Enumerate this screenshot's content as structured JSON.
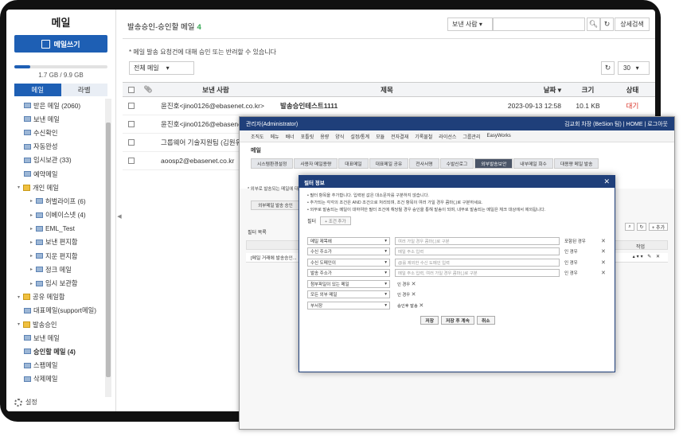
{
  "sidebar": {
    "title": "메일",
    "compose_label": "메일쓰기",
    "quota": {
      "text": "1.7 GB / 9.9 GB",
      "fraction": 0.17
    },
    "tabs": [
      "메일",
      "라벨"
    ],
    "items": [
      {
        "label": "받은 메일 (2060)",
        "icon": "mail-icon"
      },
      {
        "label": "보낸 메일",
        "icon": "mail-icon"
      },
      {
        "label": "수신확인",
        "icon": "mail-icon"
      },
      {
        "label": "자동완성",
        "icon": "mail-icon"
      },
      {
        "label": "임시보관 (33)",
        "icon": "mail-icon"
      },
      {
        "label": "예약메일",
        "icon": "mail-icon"
      },
      {
        "label": "개인 메일",
        "icon": "folder-icon"
      },
      {
        "label": "허벌라이프 (6)",
        "icon": "mail-icon"
      },
      {
        "label": "이베이스넷 (4)",
        "icon": "mail-icon"
      },
      {
        "label": "EML_Test",
        "icon": "mail-icon"
      },
      {
        "label": "보낸 편지함",
        "icon": "mail-icon"
      },
      {
        "label": "지운 편지함",
        "icon": "mail-icon"
      },
      {
        "label": "정크 메일",
        "icon": "mail-icon"
      },
      {
        "label": "임시 보관함",
        "icon": "mail-icon"
      },
      {
        "label": "공유 메일함",
        "icon": "folder-icon"
      },
      {
        "label": "대표메일(support메일)",
        "icon": "mail-icon"
      },
      {
        "label": "발송승인",
        "icon": "folder-icon"
      },
      {
        "label": "보낸 메일",
        "icon": "mail-icon"
      },
      {
        "label": "승인할 메일 (4)",
        "icon": "mail-icon"
      },
      {
        "label": "스팸메일",
        "icon": "mail-icon"
      },
      {
        "label": "삭제메일",
        "icon": "mail-icon"
      }
    ],
    "settings_label": "설정"
  },
  "main": {
    "title": "발송승인-승인할 메일",
    "count": "4",
    "search_scope": "보낸 사람",
    "search_placeholder": "",
    "detail_search": "상세검색",
    "notice": "* 메일 발송 요청건에 대해 승인 또는 반려할 수 있습니다",
    "filter": "전체 메일",
    "per_page": "30",
    "columns": {
      "sender": "보낸 사람",
      "subject": "제목",
      "date": "날짜",
      "size": "크기",
      "status": "상태"
    },
    "rows": [
      {
        "sender": "윤진호<jino0126@ebasenet.co.kr>",
        "subject": "발송승인테스트1111",
        "date": "2023-09-13 12:58",
        "size": "10.1 KB",
        "status": "대기"
      },
      {
        "sender": "윤진호<jino0126@ebasenet.co.kr>",
        "subject": "",
        "date": "",
        "size": "",
        "status": ""
      },
      {
        "sender": "그룹웨어 기술지원팀 (김원유)<s",
        "subject": "",
        "date": "",
        "size": "",
        "status": ""
      },
      {
        "sender": "aoosp2@ebasenet.co.kr",
        "subject": "",
        "date": "",
        "size": "",
        "status": ""
      }
    ]
  },
  "admin": {
    "title": "관리자(Administrator)",
    "user": "김교회 차장 (BeSion 팀)",
    "home": "HOME",
    "logout": "로그아웃",
    "nav": [
      "조직도",
      "메뉴",
      "배너",
      "포틀릿",
      "용량",
      "양식",
      "설정/통계",
      "모듈",
      "전자결재",
      "기록물철",
      "라이선스",
      "그룹관리",
      "EasyWorks"
    ],
    "section": "메일",
    "tabs": [
      "시스템환경설정",
      "사용자 메일용량",
      "대표메일",
      "대표메일 공유",
      "전사서명",
      "수발신로그",
      "외부발송보안",
      "내부메일 회수",
      "대용량 메일 발송"
    ],
    "active_tab": 6,
    "note": "* 외부로 발송되는 메일에 대...",
    "sub_tab": "외부메일 발송 승인",
    "filter_list_label": "필터 목록",
    "add_label": "+ 추가",
    "action_col": "작업",
    "list_row": "[메일 거래에 발송승인..."
  },
  "dialog": {
    "title": "필터 정보",
    "notes": [
      "• 필터 항목을 추가합니다. 입력된 값은 대소문자를 구분하지 않습니다.",
      "• 추가되는 각각의 조건은 AND 조건으로 처리되며, 조건 항목이 여러 가일 경우 콤마(,)로 구분하세요.",
      "• 외부로 발송되는 메일이 대하여만 필터 조건에 해당될 경우 승인을 통해 발송이 되며, 내부로 발송되는 메일은 체크 대상에서 제외됩니다."
    ],
    "filter_label": "필터",
    "add_condition": "+ 조건 추가",
    "conditions": [
      {
        "field": "메일 제목에",
        "value": "여러 가일 경우 콤마(,)로 구분",
        "placeholder": true,
        "type": "포함된 경우"
      },
      {
        "field": "수신 주소가",
        "value": "메일 주소 입력",
        "placeholder": true,
        "type": "인 경우"
      },
      {
        "field": "수신 도메인이",
        "value": "@를 제외한 수신 도메인 입력",
        "placeholder": true,
        "type": "인 경우"
      },
      {
        "field": "발송 주소가",
        "value": "메일 주소 입력, 여러 가일 경우 콤마(,)로 구분",
        "placeholder": true,
        "type": "인 경우"
      },
      {
        "field": "첨부파일이 있는 메일",
        "value": "인 경우",
        "placeholder": false,
        "type": ""
      },
      {
        "field": "모든 외부 메일",
        "value": "인 경우",
        "placeholder": false,
        "type": ""
      },
      {
        "field": "부서장",
        "value": "승인후 발송",
        "placeholder": false,
        "type": ""
      }
    ],
    "buttons": [
      "저장",
      "저장 후 계속",
      "취소"
    ]
  }
}
